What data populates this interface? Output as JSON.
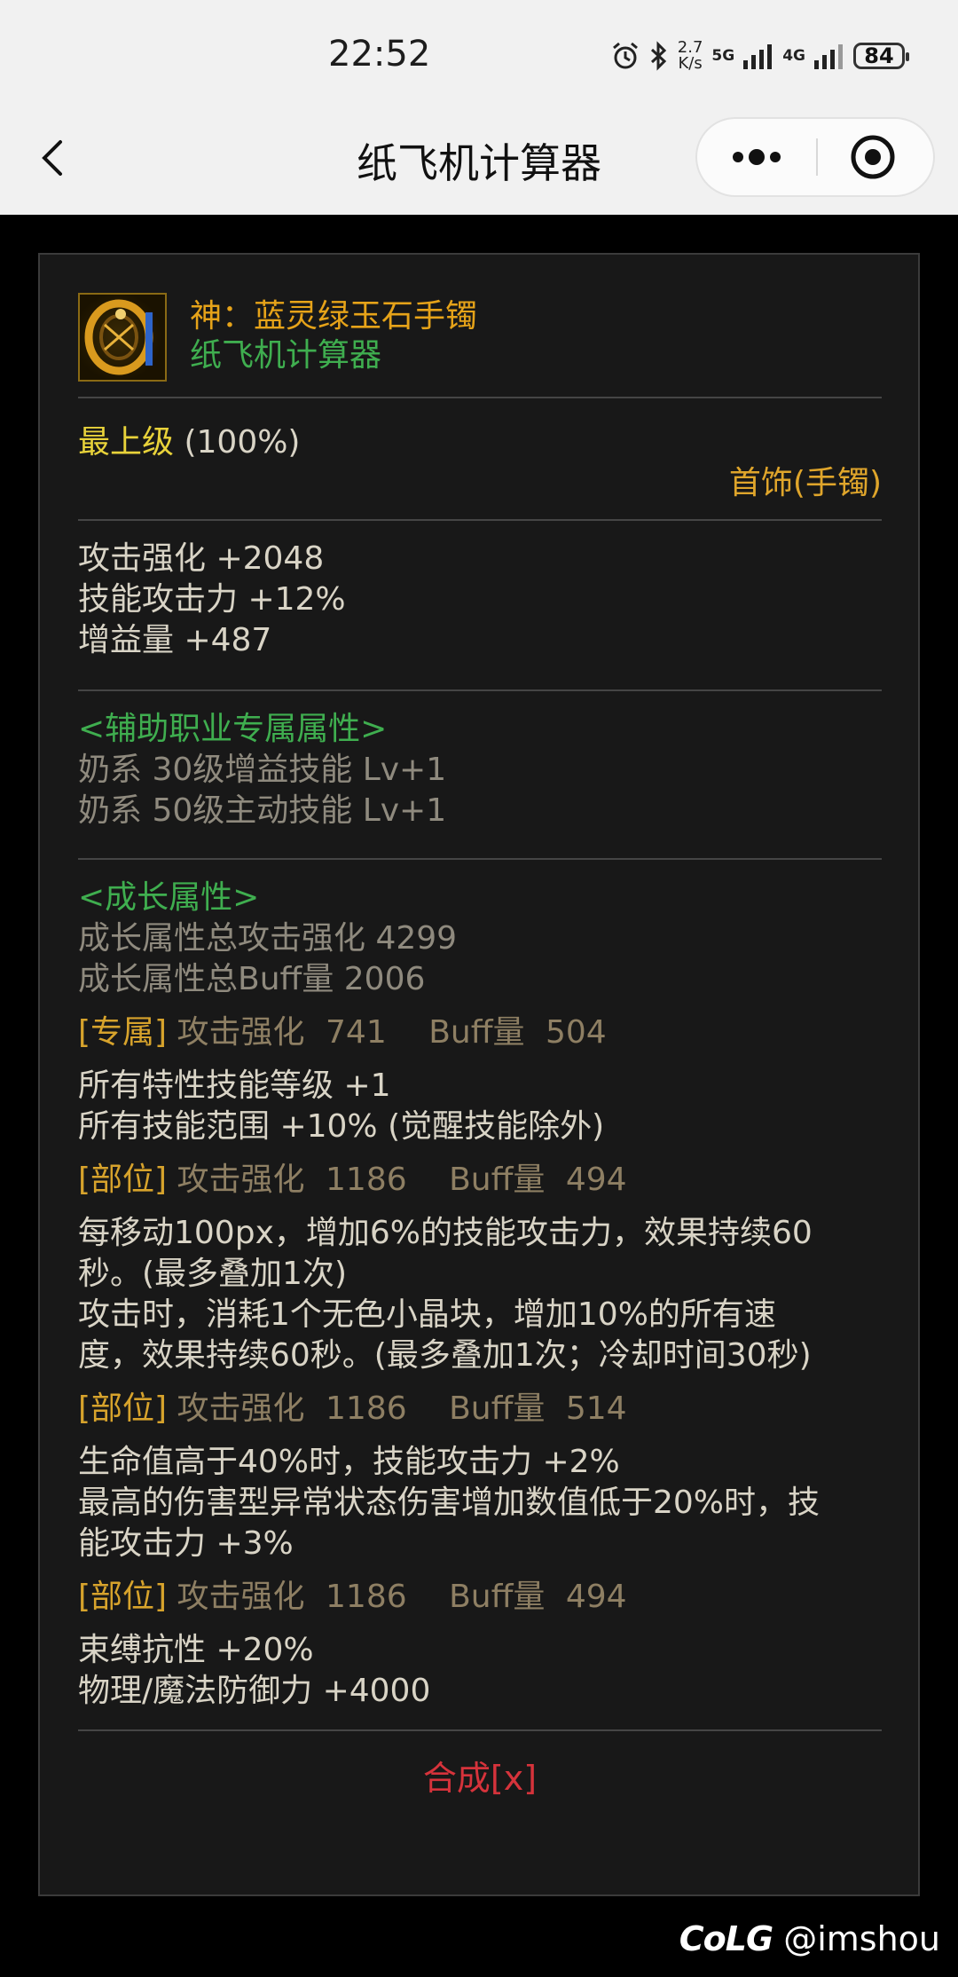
{
  "status_bar": {
    "time": "22:52",
    "net_speed_value": "2.7",
    "net_speed_unit": "K/s",
    "net_5g": "5G",
    "net_4g": "4G",
    "battery": "84"
  },
  "nav": {
    "title": "纸飞机计算器"
  },
  "item": {
    "name": "神：蓝灵绿玉石手镯",
    "source": "纸飞机计算器",
    "grade_label": "最上级",
    "grade_pct": "(100%)",
    "slot": "首饰(手镯)"
  },
  "base_stats": [
    "攻击强化 +2048",
    "技能攻击力 +12%",
    "增益量 +487"
  ],
  "support": {
    "title": "<辅助职业专属属性>",
    "lines": [
      "奶系 30级增益技能 Lv+1",
      "奶系 50级主动技能 Lv+1"
    ]
  },
  "growth": {
    "title": "<成长属性>",
    "total_attack": "成长属性总攻击强化 4299",
    "total_buff": "成长属性总Buff量 2006",
    "options": [
      {
        "tag": "[专属]",
        "attack_label": "攻击强化",
        "attack_value": "741",
        "buff_label": "Buff量",
        "buff_value": "504",
        "lines": [
          "所有特性技能等级 +1",
          "所有技能范围 +10% (觉醒技能除外)"
        ]
      },
      {
        "tag": "[部位]",
        "attack_label": "攻击强化",
        "attack_value": "1186",
        "buff_label": "Buff量",
        "buff_value": "494",
        "lines": [
          "每移动100px，增加6%的技能攻击力，效果持续60",
          "秒。(最多叠加1次)",
          "攻击时，消耗1个无色小晶块，增加10%的所有速",
          "度，效果持续60秒。(最多叠加1次；冷却时间30秒)"
        ]
      },
      {
        "tag": "[部位]",
        "attack_label": "攻击强化",
        "attack_value": "1186",
        "buff_label": "Buff量",
        "buff_value": "514",
        "lines": [
          "生命值高于40%时，技能攻击力 +2%",
          "最高的伤害型异常状态伤害增加数值低于20%时，技",
          "能攻击力 +3%"
        ]
      },
      {
        "tag": "[部位]",
        "attack_label": "攻击强化",
        "attack_value": "1186",
        "buff_label": "Buff量",
        "buff_value": "494",
        "lines": [
          "束缚抗性 +20%",
          "物理/魔法防御力 +4000"
        ]
      }
    ]
  },
  "craft_label": "合成[x]",
  "watermark": {
    "logo": "CoLG",
    "handle": "@imshou"
  },
  "icons": {
    "back": "chevron-left-icon",
    "more": "more-dots-icon",
    "close": "target-circle-icon",
    "alarm": "alarm-icon",
    "bluetooth": "bluetooth-icon",
    "signal": "signal-bars-icon"
  }
}
